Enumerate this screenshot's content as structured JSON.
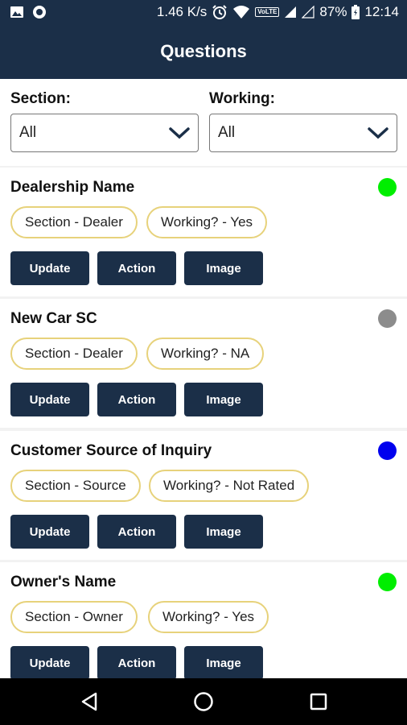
{
  "status_bar": {
    "speed": "1.46 K/s",
    "lte": "VoLTE",
    "battery": "87%",
    "time": "12:14",
    "icons": [
      "image-icon",
      "circle-icon",
      "alarm-icon",
      "wifi-icon",
      "signal-icon",
      "signal-empty-icon",
      "battery-icon"
    ]
  },
  "header": {
    "title": "Questions"
  },
  "filters": {
    "section": {
      "label": "Section:",
      "value": "All"
    },
    "working": {
      "label": "Working:",
      "value": "All"
    }
  },
  "buttons": {
    "update": "Update",
    "action": "Action",
    "image": "Image"
  },
  "questions": [
    {
      "title": "Dealership Name",
      "status_color": "#00ee00",
      "section_chip": "Section - Dealer",
      "working_chip": "Working? - Yes"
    },
    {
      "title": "New Car SC",
      "status_color": "#8c8c8c",
      "section_chip": "Section - Dealer",
      "working_chip": "Working? - NA"
    },
    {
      "title": "Customer Source of Inquiry",
      "status_color": "#0000ee",
      "section_chip": "Section - Source",
      "working_chip": "Working? - Not Rated"
    },
    {
      "title": "Owner's Name",
      "status_color": "#00ee00",
      "section_chip": "Section - Owner",
      "working_chip": "Working? - Yes"
    }
  ],
  "colors": {
    "primary": "#1b2f48",
    "chip_border": "#e7d27b"
  }
}
